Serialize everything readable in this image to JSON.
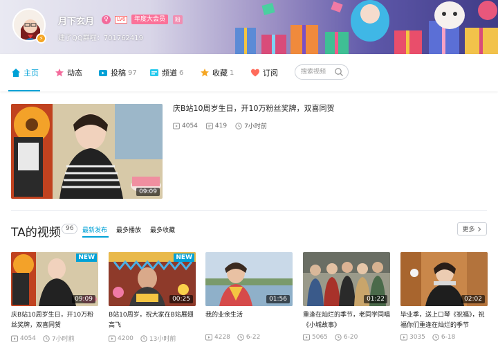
{
  "profile": {
    "username": "月下玄月",
    "gender_symbol": "♀",
    "level": "LV6",
    "vip_label": "年度大会员",
    "fans_badge": "粉",
    "group_text": "建了QQ群啦：701762419",
    "avatar_badge": "⚡"
  },
  "nav": {
    "items": [
      {
        "label": "主页",
        "count": ""
      },
      {
        "label": "动态",
        "count": ""
      },
      {
        "label": "投稿",
        "count": "97"
      },
      {
        "label": "频道",
        "count": "6"
      },
      {
        "label": "收藏",
        "count": "1"
      },
      {
        "label": "订阅",
        "count": ""
      }
    ],
    "search_placeholder": "搜索视频"
  },
  "featured": {
    "title": "庆B站10周岁生日，开10万粉丝奖牌，双喜同贺",
    "duration": "09:09",
    "plays": "4054",
    "danmaku": "419",
    "time": "7小时前"
  },
  "videos_section": {
    "title": "TA的视频",
    "count": "96",
    "sort_tabs": [
      "最新发布",
      "最多播放",
      "最多收藏"
    ],
    "more_label": "更多"
  },
  "videos": [
    {
      "title": "庆B站10周岁生日，开10万粉丝奖牌，双喜同贺",
      "duration": "09:09",
      "badge": "NEW",
      "plays": "4054",
      "time": "7小时前"
    },
    {
      "title": "B站10周岁，祝大家在B站展翅高飞",
      "duration": "00:25",
      "badge": "NEW",
      "plays": "4200",
      "time": "13小时前"
    },
    {
      "title": "我的业余生活",
      "duration": "01:56",
      "badge": "",
      "plays": "4228",
      "time": "6-22"
    },
    {
      "title": "重逢在灿烂的季节，老同学同唱《小城故事》",
      "duration": "01:22",
      "badge": "",
      "plays": "5065",
      "time": "6-20"
    },
    {
      "title": "毕业季，送上口琴《祝福》，祝福你们重逢在灿烂的季节",
      "duration": "02:02",
      "badge": "",
      "plays": "3035",
      "time": "6-18"
    }
  ],
  "colors": {
    "accent": "#00a1d6",
    "pink": "#fb7299",
    "nav_home": "#00a1d6",
    "nav_dynamic": "#f36a9b",
    "nav_contrib": "#00a1d6",
    "nav_channel": "#23c9ed",
    "nav_fav": "#f5a623",
    "nav_sub": "#ff6b5b"
  }
}
